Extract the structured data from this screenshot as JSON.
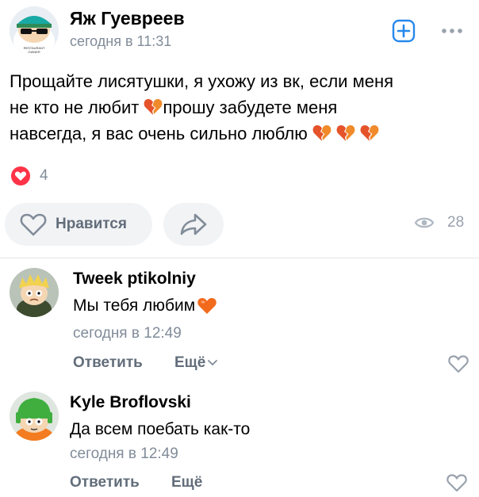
{
  "post": {
    "author": "Яж Гуевреев",
    "time": "сегодня в 11:31",
    "text_line1": "Прощайте лисятушки, я ухожу из вк, если меня",
    "text_line2_a": "не кто не любит ",
    "text_line2_b": "прошу забудете меня",
    "text_line3": "навсегда, я вас очень сильно люблю ",
    "reactions_count": "4",
    "like_label": "Нравится",
    "views_count": "28",
    "accent_color": "#2688eb",
    "icons": [
      "add-square-icon",
      "more-dots-icon",
      "heart-reaction-icon",
      "heart-outline-icon",
      "share-icon",
      "eye-icon",
      "broken-heart-emoji",
      "orange-heart-emoji"
    ]
  },
  "comments": [
    {
      "author": "Tweek ptikolniy",
      "text": "Мы тебя любим ",
      "time": "сегодня в 12:49",
      "reply_label": "Ответить",
      "more_label": "Ещё"
    },
    {
      "author": "Kyle Broflovski",
      "text": "Да всем поебать как-то",
      "time": "сегодня в 12:49",
      "reply_label": "Ответить",
      "more_label": "Ещё"
    }
  ]
}
